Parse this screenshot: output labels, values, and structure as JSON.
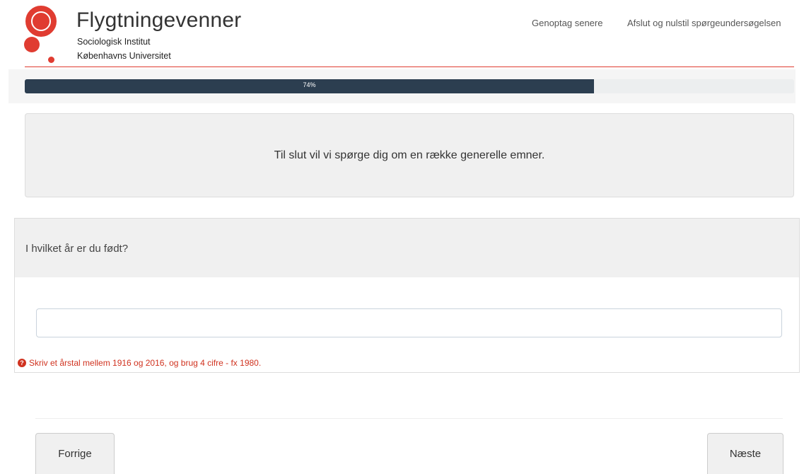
{
  "header": {
    "brand_title": "Flygtningevenner",
    "brand_sub1": "Sociologisk Institut",
    "brand_sub2": "Københavns Universitet",
    "nav": {
      "resume_label": "Genoptag senere",
      "quit_label": "Afslut og nulstil spørgeundersøgelsen"
    }
  },
  "progress": {
    "percent": 74,
    "label": "74%"
  },
  "intro": {
    "text": "Til slut vil vi spørge dig om en række generelle emner."
  },
  "question": {
    "text": "I hvilket år er du født?",
    "input_value": "",
    "error_text": "Skriv et årstal mellem 1916 og 2016, og brug 4 cifre - fx 1980."
  },
  "footer": {
    "prev_label": "Forrige",
    "next_label": "Næste"
  },
  "colors": {
    "accent": "#e03c31",
    "progress_fill": "#2c3e50",
    "error": "#d0321f"
  },
  "icons": {
    "logo": "university-seal-icon",
    "error": "question-circle-icon"
  }
}
